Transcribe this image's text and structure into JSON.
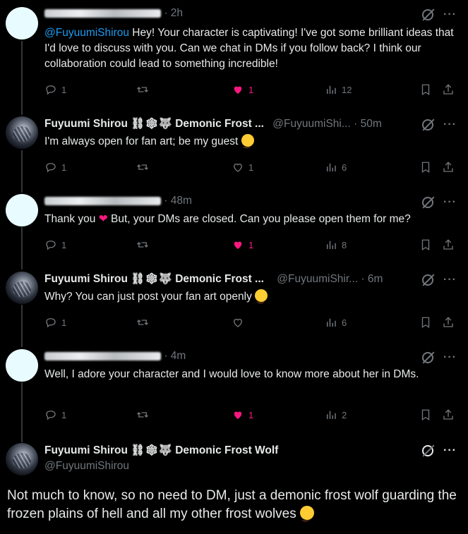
{
  "tweets": [
    {
      "author_name": "",
      "handle": "",
      "time": "2h",
      "redacted": true,
      "mention": "@FuyuumiShirou",
      "text": " Hey! Your character is captivating! I've got some brilliant ideas that I'd love to discuss with you. Can we chat in DMs if you follow back? I think our collaboration could lead to something incredible!",
      "replies": "1",
      "retweets": "",
      "likes": "1",
      "liked": true,
      "views": "12"
    },
    {
      "author_name": "Fuyuumi Shirou ⛓❄🐺 Demonic Frost ...",
      "handle": "@FuyuumiShi...",
      "time": "50m",
      "redacted": false,
      "text": "I'm always open for fan art; be my guest",
      "replies": "1",
      "retweets": "",
      "likes": "1",
      "liked": false,
      "views": "6"
    },
    {
      "author_name": "",
      "handle": "",
      "time": "48m",
      "redacted": true,
      "text_before": "Thank you ",
      "text_after": " But, your DMs are closed. Can you please open them for me?",
      "replies": "1",
      "retweets": "",
      "likes": "1",
      "liked": true,
      "views": "8"
    },
    {
      "author_name": "Fuyuumi Shirou ⛓❄🐺 Demonic Frost ...",
      "handle": "@FuyuumiShir...",
      "time": "6m",
      "redacted": false,
      "text": "Why? You can just post your fan art openly",
      "replies": "1",
      "retweets": "",
      "likes": "",
      "liked": false,
      "views": "6"
    },
    {
      "author_name": "",
      "handle": "",
      "time": "4m",
      "redacted": true,
      "text": "Well, I adore your character and I would love to know more about her in DMs.",
      "replies": "1",
      "retweets": "",
      "likes": "1",
      "liked": true,
      "views": "2"
    }
  ],
  "main_tweet": {
    "author_name": "Fuyuumi Shirou ⛓❄🐺 Demonic Frost Wolf",
    "handle": "@FuyuumiShirou",
    "text": "Not much to know, so no need to DM, just a demonic frost wolf guarding the frozen plains of hell and all my other frost wolves"
  },
  "icons": {
    "reply": "reply-icon",
    "retweet": "retweet-icon",
    "like": "heart-icon",
    "views": "views-icon",
    "bookmark": "bookmark-icon",
    "share": "share-icon",
    "grok": "grok-icon",
    "more": "more-icon"
  },
  "colors": {
    "accent": "#1d9bf0",
    "like": "#f91880",
    "muted": "#71767b",
    "background": "#000000"
  }
}
